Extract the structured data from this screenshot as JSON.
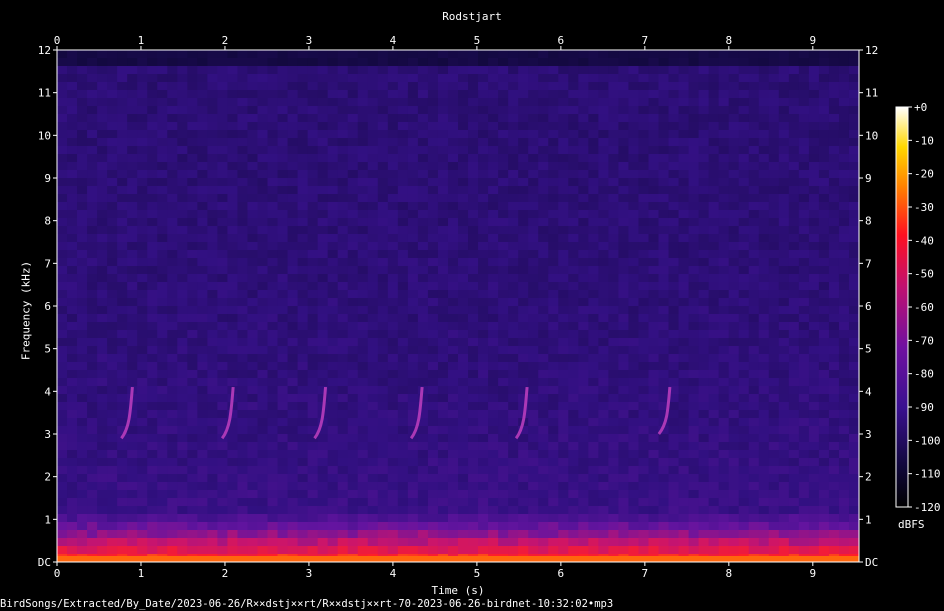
{
  "chart_data": {
    "type": "heatmap",
    "title": "Rodstjart",
    "xlabel": "Time (s)",
    "ylabel": "Frequency (kHz)",
    "xlim": [
      0,
      9.55
    ],
    "ylim": [
      0,
      12
    ],
    "x_ticks": [
      "0",
      "1",
      "2",
      "3",
      "4",
      "5",
      "6",
      "7",
      "8",
      "9"
    ],
    "y_ticks": [
      "DC",
      "1",
      "2",
      "3",
      "4",
      "5",
      "6",
      "7",
      "8",
      "9",
      "10",
      "11",
      "12"
    ],
    "colorbar": {
      "unit": "dBFS",
      "range": [
        -120,
        0
      ],
      "ticks": [
        "+0",
        "-10",
        "-20",
        "-30",
        "-40",
        "-50",
        "-60",
        "-70",
        "-80",
        "-90",
        "-100",
        "-110",
        "-120"
      ]
    },
    "calls": [
      {
        "time_s": 0.85,
        "freq_low_khz": 2.9,
        "freq_high_khz": 4.1
      },
      {
        "time_s": 2.05,
        "freq_low_khz": 2.9,
        "freq_high_khz": 4.1
      },
      {
        "time_s": 3.15,
        "freq_low_khz": 2.9,
        "freq_high_khz": 4.1
      },
      {
        "time_s": 4.3,
        "freq_low_khz": 2.9,
        "freq_high_khz": 4.1
      },
      {
        "time_s": 5.55,
        "freq_low_khz": 2.9,
        "freq_high_khz": 4.1
      },
      {
        "time_s": 7.25,
        "freq_low_khz": 3.0,
        "freq_high_khz": 4.1
      }
    ],
    "colors": {
      "background": "#000000",
      "noise_floor": "#2a1070",
      "band_energy": "#ff3030"
    }
  },
  "footer": {
    "file_path": "BirdSongs/Extracted/By_Date/2023-06-26/R××dstj××rt/R××dstj××rt-70-2023-06-26-birdnet-10:32:02•mp3"
  }
}
